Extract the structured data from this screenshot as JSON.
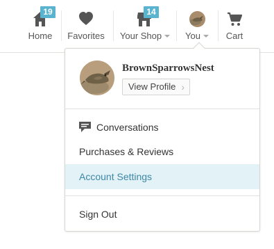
{
  "nav": {
    "items": [
      {
        "label": "Home",
        "icon": "home-icon",
        "badge": "19"
      },
      {
        "label": "Favorites",
        "icon": "heart-icon"
      },
      {
        "label": "Your Shop",
        "icon": "shop-icon",
        "badge": "14",
        "has_caret": true
      },
      {
        "label": "You",
        "icon": "avatar",
        "has_caret": true
      },
      {
        "label": "Cart",
        "icon": "cart-icon"
      }
    ]
  },
  "dropdown": {
    "shop_name": "BrownSparrowsNest",
    "view_profile_label": "View Profile",
    "menu": [
      {
        "label": "Conversations",
        "icon": "speech-bubble-icon"
      },
      {
        "label": "Purchases & Reviews"
      },
      {
        "label": "Account Settings",
        "active": true
      },
      {
        "label": "Sign Out"
      }
    ]
  },
  "colors": {
    "badge": "#5bb4cf",
    "icon": "#555555",
    "active_bg": "#e3f2f7",
    "active_text": "#3d87a6"
  }
}
